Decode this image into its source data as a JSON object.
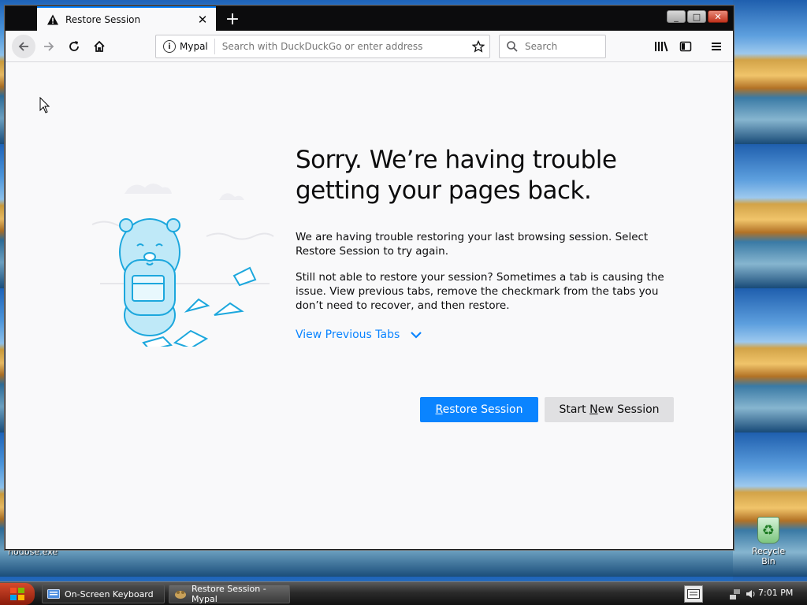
{
  "desktop": {
    "icons": [
      {
        "label": "Recycle Bin",
        "icon": "recycle-bin-icon"
      }
    ],
    "stray_label": "nodbse.exe"
  },
  "browser": {
    "tab": {
      "title": "Restore Session",
      "icon": "warning-icon"
    },
    "window_controls": {
      "minimize": "_",
      "maximize": "□",
      "close": "✕"
    },
    "urlbar": {
      "site_label": "Mypal",
      "placeholder": "Search with DuckDuckGo or enter address"
    },
    "searchbar": {
      "placeholder": "Search"
    }
  },
  "page": {
    "heading": "Sorry. We’re having trouble getting your pages back.",
    "paragraph1": "We are having trouble restoring your last browsing session. Select Restore Session to try again.",
    "paragraph2": "Still not able to restore your session? Sometimes a tab is causing the issue. View previous tabs, remove the checkmark from the tabs you don’t need to recover, and then restore.",
    "view_previous_tabs": "View Previous Tabs",
    "restore_button": {
      "prefix": "",
      "accel": "R",
      "suffix": "estore Session"
    },
    "new_session_button": {
      "prefix": "Start ",
      "accel": "N",
      "suffix": "ew Session"
    },
    "accent_color": "#0a84ff"
  },
  "taskbar": {
    "tasks": [
      {
        "label": "On-Screen Keyboard",
        "icon": "keyboard-icon"
      },
      {
        "label": "Restore Session - Mypal",
        "icon": "mypal-icon"
      }
    ],
    "clock": "7:01 PM"
  }
}
